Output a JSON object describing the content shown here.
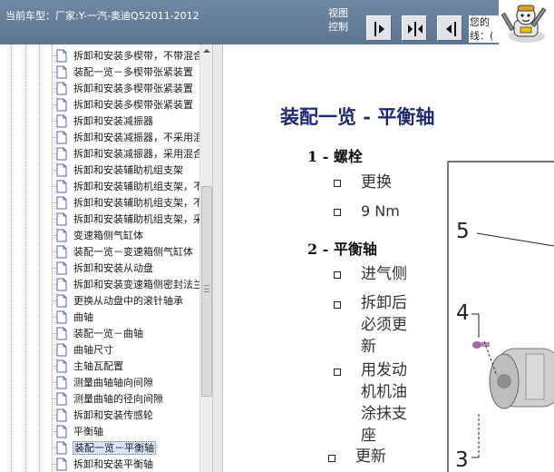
{
  "header": {
    "vehicle_text": "当前车型：厂家:Y-一汽-奥迪Q52011-2012",
    "view_control_label": "视图控制",
    "user_info_text": "您的线：(",
    "buttons": [
      {
        "icon": "panel-left-arrow-icon"
      },
      {
        "icon": "panel-split-arrows-icon"
      },
      {
        "icon": "panel-right-arrow-icon"
      }
    ]
  },
  "tree": {
    "items": [
      {
        "label": "拆卸和安装多楔带，不带混合"
      },
      {
        "label": "装配一览－多楔带张紧装置"
      },
      {
        "label": "拆卸和安装多楔带张紧装置"
      },
      {
        "label": "拆卸和安装多楔带张紧装置"
      },
      {
        "label": "拆卸和安装减振器"
      },
      {
        "label": "拆卸和安装减振器，不采用混"
      },
      {
        "label": "拆卸和安装减振器，采用混合"
      },
      {
        "label": "拆卸和安装辅助机组支架"
      },
      {
        "label": "拆卸和安装辅助机组支架，不"
      },
      {
        "label": "拆卸和安装辅助机组支架，不"
      },
      {
        "label": "拆卸和安装辅助机组支架，采"
      },
      {
        "label": "变速箱侧气缸体"
      },
      {
        "label": "装配一览－变速箱侧气缸体"
      },
      {
        "label": "拆卸和安装从动盘"
      },
      {
        "label": "拆卸和安装变速箱侧密封法兰"
      },
      {
        "label": "更换从动盘中的滚针轴承"
      },
      {
        "label": "曲轴"
      },
      {
        "label": "装配一览－曲轴"
      },
      {
        "label": "曲轴尺寸"
      },
      {
        "label": "主轴瓦配置"
      },
      {
        "label": "测量曲轴轴向间隙"
      },
      {
        "label": "测量曲轴的径向间隙"
      },
      {
        "label": "拆卸和安装传感轮"
      },
      {
        "label": "平衡轴"
      },
      {
        "label": "装配一览－平衡轴",
        "selected": true
      },
      {
        "label": "拆卸和安装平衡轴"
      }
    ]
  },
  "content": {
    "title": "装配一览 - 平衡轴",
    "sections": [
      {
        "heading": "1 - 螺栓",
        "items": [
          "更换",
          "9 Nm"
        ]
      },
      {
        "heading": "2 - 平衡轴",
        "items": [
          "进气侧",
          "拆卸后必须更新",
          "用发动机机油涂抹支座",
          "更新"
        ]
      }
    ],
    "callouts": [
      "5",
      "4",
      "3"
    ]
  },
  "colors": {
    "header_bg": "#6585a0",
    "title": "#1f2a73",
    "selection_bg": "#d6e4f4"
  }
}
